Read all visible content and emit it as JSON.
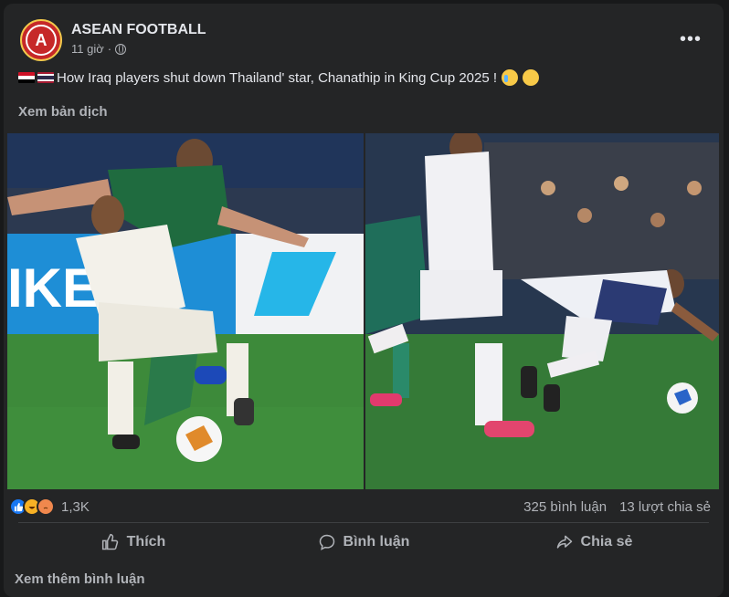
{
  "post": {
    "page_name": "ASEAN FOOTBALL",
    "time": "11 giờ",
    "separator": "·",
    "caption_text": "How Iraq players shut down Thailand' star, Chanathip in King Cup 2025 !",
    "translate_label": "Xem bản dịch"
  },
  "stats": {
    "reaction_count": "1,3K",
    "comments": "325 bình luận",
    "shares": "13 lượt chia sẻ"
  },
  "actions": {
    "like_label": "Thích",
    "comment_label": "Bình luận",
    "share_label": "Chia sẻ"
  },
  "footer": {
    "more_comments": "Xem thêm bình luận"
  },
  "icons": [
    "page-avatar-icon",
    "globe-icon",
    "more-options-icon",
    "iraq-flag-icon",
    "thailand-flag-icon",
    "crying-emoji-icon",
    "astonished-emoji-icon",
    "like-reaction-icon",
    "haha-reaction-icon",
    "angry-reaction-icon",
    "thumbs-up-icon",
    "comment-bubble-icon",
    "share-arrow-icon"
  ],
  "colors": {
    "background": "#242526",
    "text": "#e4e6eb",
    "secondary_text": "#b0b3b8",
    "like_blue": "#1877f2"
  }
}
